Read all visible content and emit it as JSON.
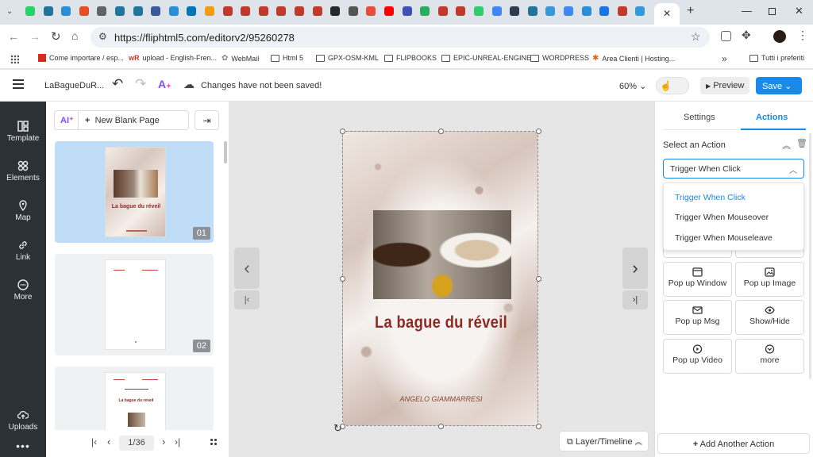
{
  "browser": {
    "url": "https://fliphtml5.com/editorv2/95260278",
    "bookmarks": [
      "Come importare / esp...",
      "upload - English-Fren...",
      "WebMail",
      "Html 5",
      "GPX-OSM-KML",
      "FLIPBOOKS",
      "EPIC-UNREAL-ENGINE",
      "WORDPRESS",
      "Area Clienti | Hosting...",
      "Tutti i preferiti"
    ]
  },
  "header": {
    "doc_title": "LaBagueDuR...",
    "save_status": "Changes have not been saved!",
    "zoom": "60%",
    "preview_label": "Preview",
    "save_label": "Save"
  },
  "rail": [
    "Template",
    "Elements",
    "Map",
    "Link",
    "More",
    "Uploads"
  ],
  "thumbs": {
    "ai_label": "AI",
    "new_page_label": "New Blank Page",
    "page_numbers": [
      "01",
      "02"
    ],
    "thumb1_title": "La bague du réveil",
    "thumb3_title": "La bague du réveil",
    "pager": "1/36"
  },
  "page": {
    "title": "La bague du réveil",
    "author": "ANGELO GIAMMARRESI"
  },
  "layer_label": "Layer/Timeline",
  "panel": {
    "tabs": [
      "Settings",
      "Actions"
    ],
    "active_tab": "Actions",
    "select_heading": "Select an Action",
    "trigger_value": "Trigger When Click",
    "trigger_options": [
      "Trigger When Click",
      "Trigger When Mouseover",
      "Trigger When Mouseleave"
    ],
    "actions": [
      "Pop up Window",
      "Pop up Image",
      "Pop up Msg",
      "Show/Hide",
      "Pop up Video",
      "more"
    ],
    "add_action": "Add Another Action"
  },
  "colors": {
    "accent": "#1a8ae8",
    "rail": "#2c3138",
    "title_red": "#8e2a22"
  }
}
